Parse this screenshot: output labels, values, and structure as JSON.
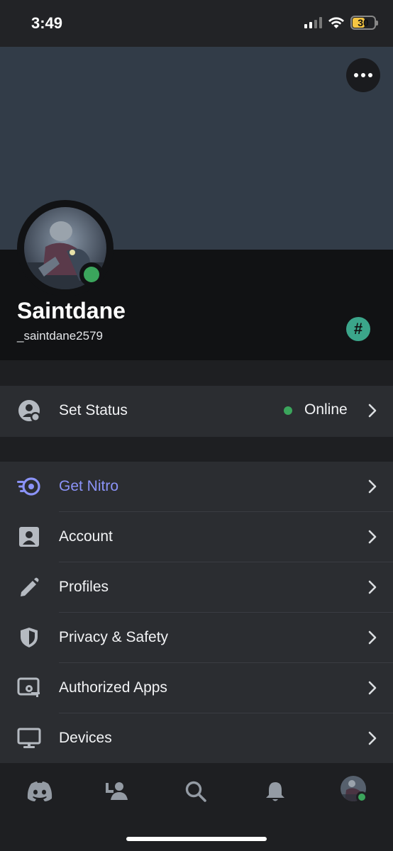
{
  "status_bar": {
    "time": "3:49",
    "battery": "30"
  },
  "profile": {
    "display_name": "Saintdane",
    "username": "_saintdane2579",
    "badge_glyph": "#",
    "status": "online"
  },
  "status_row": {
    "label": "Set Status",
    "value": "Online"
  },
  "menu": [
    {
      "label": "Get Nitro",
      "icon": "nitro-icon",
      "accent": "#8b93f8"
    },
    {
      "label": "Account",
      "icon": "account-icon"
    },
    {
      "label": "Profiles",
      "icon": "pencil-icon"
    },
    {
      "label": "Privacy & Safety",
      "icon": "shield-icon"
    },
    {
      "label": "Authorized Apps",
      "icon": "authorized-apps-icon"
    },
    {
      "label": "Devices",
      "icon": "monitor-icon"
    }
  ],
  "bottom_nav": [
    {
      "icon": "discord-home-icon"
    },
    {
      "icon": "friends-icon"
    },
    {
      "icon": "search-icon"
    },
    {
      "icon": "bell-icon"
    },
    {
      "icon": "profile-avatar-icon"
    }
  ],
  "colors": {
    "banner": "#323c48",
    "accent_nitro": "#8b93f8",
    "online": "#3ba55c",
    "row_bg": "#2b2d31"
  }
}
